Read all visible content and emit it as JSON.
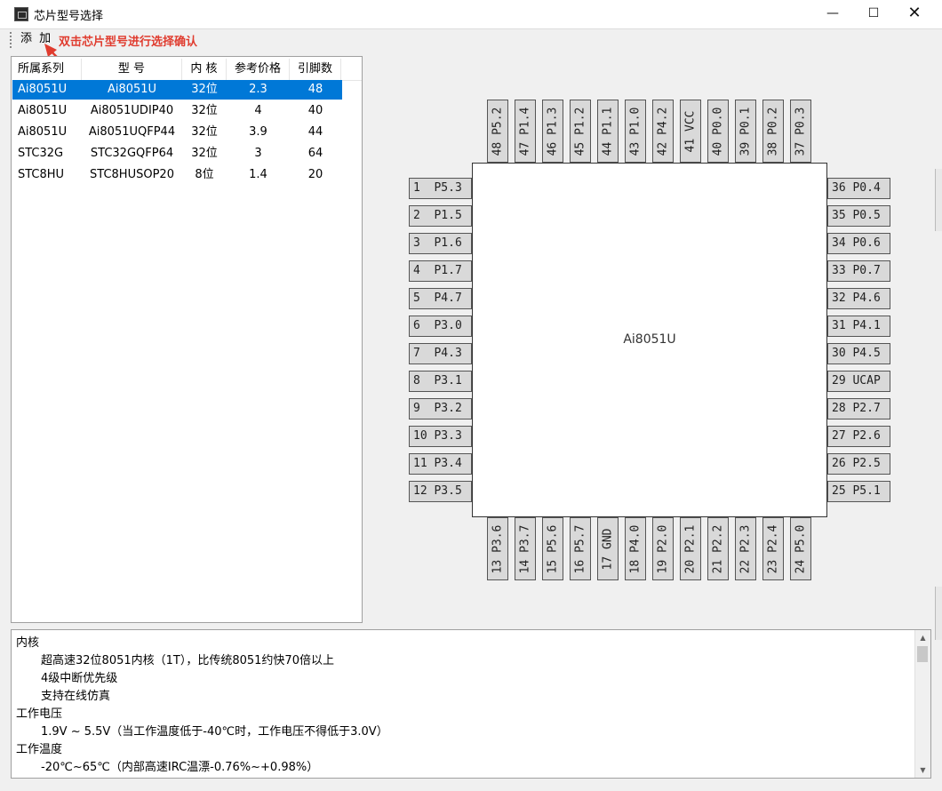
{
  "window": {
    "title": "芯片型号选择",
    "minimize": "—",
    "maximize": "☐",
    "close": "✕"
  },
  "toolbar": {
    "add_label": "添 加",
    "hint": "双击芯片型号进行选择确认"
  },
  "table": {
    "columns": [
      "所属系列",
      "型 号",
      "内 核",
      "参考价格",
      "引脚数"
    ],
    "rows": [
      [
        "Ai8051U",
        "Ai8051U",
        "32位",
        "2.3",
        "48"
      ],
      [
        "Ai8051U",
        "Ai8051UDIP40",
        "32位",
        "4",
        "40"
      ],
      [
        "Ai8051U",
        "Ai8051UQFP44",
        "32位",
        "3.9",
        "44"
      ],
      [
        "STC32G",
        "STC32GQFP64",
        "32位",
        "3",
        "64"
      ],
      [
        "STC8HU",
        "STC8HUSOP20",
        "8位",
        "1.4",
        "20"
      ]
    ],
    "selected_index": 0
  },
  "chip": {
    "name": "Ai8051U",
    "left_pins": [
      "1  P5.3",
      "2  P1.5",
      "3  P1.6",
      "4  P1.7",
      "5  P4.7",
      "6  P3.0",
      "7  P4.3",
      "8  P3.1",
      "9  P3.2",
      "10 P3.3",
      "11 P3.4",
      "12 P3.5"
    ],
    "bottom_pins": [
      "13 P3.6",
      "14 P3.7",
      "15 P5.6",
      "16 P5.7",
      "17 GND",
      "18 P4.0",
      "19 P2.0",
      "20 P2.1",
      "21 P2.2",
      "22 P2.3",
      "23 P2.4",
      "24 P5.0"
    ],
    "right_pins": [
      "36 P0.4",
      "35 P0.5",
      "34 P0.6",
      "33 P0.7",
      "32 P4.6",
      "31 P4.1",
      "30 P4.5",
      "29 UCAP",
      "28 P2.7",
      "27 P2.6",
      "26 P2.5",
      "25 P5.1"
    ],
    "top_pins": [
      "48 P5.2",
      "47 P1.4",
      "46 P1.3",
      "45 P1.2",
      "44 P1.1",
      "43 P1.0",
      "42 P4.2",
      "41 VCC",
      "40 P0.0",
      "39 P0.1",
      "38 P0.2",
      "37 P0.3"
    ]
  },
  "description": [
    {
      "text": "内核",
      "indent": false
    },
    {
      "text": "超高速32位8051内核（1T），比传统8051约快70倍以上",
      "indent": true
    },
    {
      "text": "4级中断优先级",
      "indent": true
    },
    {
      "text": "支持在线仿真",
      "indent": true
    },
    {
      "text": "工作电压",
      "indent": false
    },
    {
      "text": "1.9V ~ 5.5V（当工作温度低于-40℃时，工作电压不得低于3.0V）",
      "indent": true
    },
    {
      "text": "工作温度",
      "indent": false
    },
    {
      "text": "-20℃~65℃（内部高速IRC温漂-0.76%~+0.98%）",
      "indent": true
    }
  ],
  "colors": {
    "selection": "#0078d7",
    "hint": "#e03c2f",
    "pin_fill": "#d9d9d9"
  }
}
